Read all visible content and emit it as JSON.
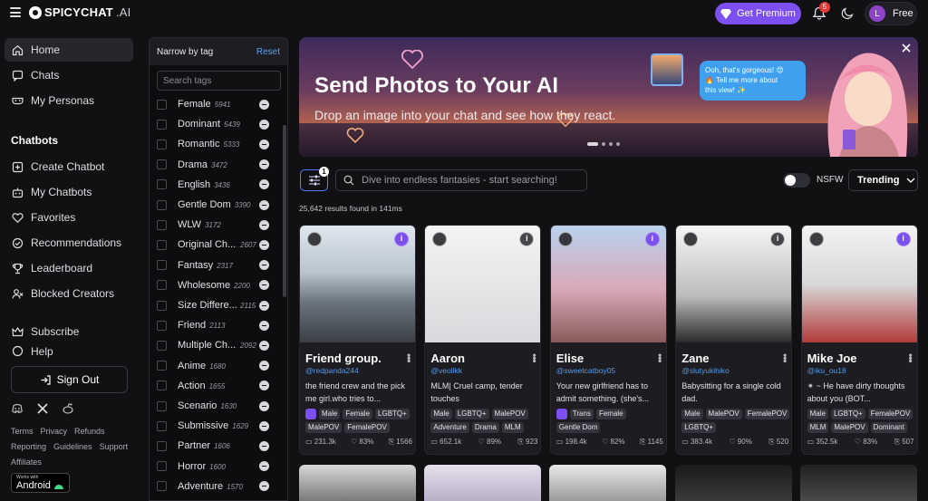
{
  "app": {
    "logo_main": "SPICYCHAT",
    "logo_suffix": ".AI",
    "premium_label": "Get Premium",
    "notification_count": "5",
    "user_initial": "L",
    "plan": "Free"
  },
  "sidebar": {
    "items": [
      {
        "label": "Home",
        "icon": "home-icon"
      },
      {
        "label": "Chats",
        "icon": "chat-icon"
      },
      {
        "label": "My Personas",
        "icon": "mask-icon"
      }
    ],
    "section_title": "Chatbots",
    "chatbot_items": [
      {
        "label": "Create Chatbot",
        "icon": "plus-square-icon"
      },
      {
        "label": "My Chatbots",
        "icon": "bot-icon"
      },
      {
        "label": "Favorites",
        "icon": "heart-icon"
      },
      {
        "label": "Recommendations",
        "icon": "check-circle-icon"
      },
      {
        "label": "Leaderboard",
        "icon": "trophy-icon"
      },
      {
        "label": "Blocked Creators",
        "icon": "user-block-icon"
      }
    ],
    "extra_items": [
      {
        "label": "Subscribe",
        "icon": "crown-icon"
      },
      {
        "label": "Help",
        "icon": "help-icon"
      }
    ],
    "sign_out": "Sign Out",
    "footer_links": [
      "Terms",
      "Privacy",
      "Refunds",
      "Reporting",
      "Guidelines",
      "Support",
      "Affiliates"
    ],
    "android_small": "Works with",
    "android_big": "Android"
  },
  "tag_panel": {
    "title": "Narrow by tag",
    "reset": "Reset",
    "search_placeholder": "Search tags",
    "tags": [
      {
        "name": "Female",
        "count": "5941"
      },
      {
        "name": "Dominant",
        "count": "5439"
      },
      {
        "name": "Romantic",
        "count": "5333"
      },
      {
        "name": "Drama",
        "count": "3472"
      },
      {
        "name": "English",
        "count": "3436"
      },
      {
        "name": "Gentle Dom",
        "count": "3390"
      },
      {
        "name": "WLW",
        "count": "3172"
      },
      {
        "name": "Original Ch...",
        "count": "2607"
      },
      {
        "name": "Fantasy",
        "count": "2317"
      },
      {
        "name": "Wholesome",
        "count": "2200"
      },
      {
        "name": "Size Differe...",
        "count": "2115"
      },
      {
        "name": "Friend",
        "count": "2113"
      },
      {
        "name": "Multiple Ch...",
        "count": "2092"
      },
      {
        "name": "Anime",
        "count": "1680"
      },
      {
        "name": "Action",
        "count": "1655"
      },
      {
        "name": "Scenario",
        "count": "1630"
      },
      {
        "name": "Submissive",
        "count": "1629"
      },
      {
        "name": "Partner",
        "count": "1606"
      },
      {
        "name": "Horror",
        "count": "1600"
      },
      {
        "name": "Adventure",
        "count": "1570"
      }
    ]
  },
  "banner": {
    "title": "Send Photos to Your AI",
    "subtitle": "Drop an image into your chat and see how they react.",
    "bubble_line1": "Ooh, that's gorgeous! 😍",
    "bubble_line2": "🔥 Tell me more about",
    "bubble_line3": "this view! ✨"
  },
  "toolbar": {
    "filter_count": "1",
    "search_placeholder": "Dive into endless fantasies - start searching!",
    "nsfw_label": "NSFW",
    "sort_value": "Trending",
    "results": "25,642 results found in 141ms"
  },
  "cards": [
    {
      "title": "Friend group.",
      "handle": "@redpanda244",
      "desc": "the friend crew and the pick me girl.who tries to...",
      "tags": [
        "Male",
        "Female",
        "LGBTQ+",
        "MalePOV",
        "FemalePOV"
      ],
      "tag_icon": true,
      "messages": "231.3k",
      "rating": "83%",
      "chars": "1566",
      "info": "purple"
    },
    {
      "title": "Aaron",
      "handle": "@veollkk",
      "desc": "MLM| Cruel camp, tender touches",
      "tags": [
        "Male",
        "LGBTQ+",
        "MalePOV",
        "Adventure",
        "Drama",
        "MLM"
      ],
      "tag_icon": false,
      "messages": "652.1k",
      "rating": "89%",
      "chars": "923",
      "info": "grey"
    },
    {
      "title": "Elise",
      "handle": "@sweetcatboy05",
      "desc": "Your new girlfriend has to admit something. (she's...",
      "tags": [
        "Trans",
        "Female",
        "Gentle Dom"
      ],
      "tag_icon": true,
      "messages": "198.4k",
      "rating": "82%",
      "chars": "1145",
      "info": "purple"
    },
    {
      "title": "Zane",
      "handle": "@slutyukihiko",
      "desc": "Babysitting for a single cold dad.",
      "tags": [
        "Male",
        "MalePOV",
        "FemalePOV",
        "LGBTQ+"
      ],
      "tag_icon": false,
      "messages": "383.4k",
      "rating": "90%",
      "chars": "520",
      "info": "grey"
    },
    {
      "title": "Mike Joe",
      "handle": "@iku_ou18",
      "desc": "✴︎ ~ He have dirty thoughts about you (BOT...",
      "tags": [
        "Male",
        "LGBTQ+",
        "FemalePOV",
        "MLM",
        "MalePOV",
        "Dominant"
      ],
      "tag_icon": false,
      "messages": "352.5k",
      "rating": "83%",
      "chars": "507",
      "info": "purple"
    }
  ]
}
